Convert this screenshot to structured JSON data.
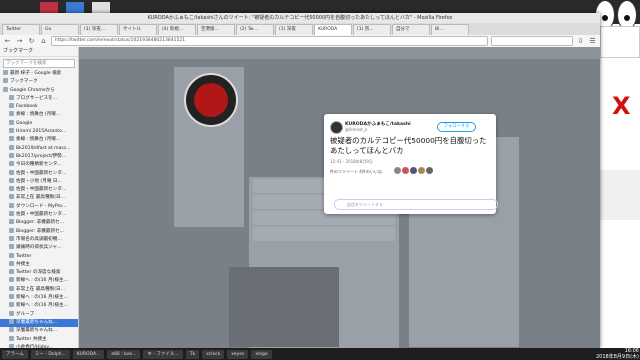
{
  "window": {
    "title": "KURODAかふぁもこ/takashiさんのツイート: \"被疑者のカルテコピー代50000円を自腹切ったあたしってほんとバカ\" - Mozilla Firefox"
  },
  "tabs": [
    "Twitter",
    "Go",
    "(1) 深夜...",
    "サイトル",
    "(4) 新規...",
    "空港版...",
    "(2) Tw...",
    "(1) 深夜",
    "KURODA",
    "(1) 宗...",
    "自分で",
    "Bl..."
  ],
  "url": "https://twitter.com/lemeat/status/1021938480213841521",
  "bookmarks": {
    "title": "ブックマーク",
    "search_placeholder": "ブックマークを検索",
    "items": [
      {
        "label": "最新 梓子 - Google 検索",
        "selected": false
      },
      {
        "label": "ブックマーク",
        "selected": false
      },
      {
        "label": "Google Chromeから",
        "selected": false
      },
      {
        "label": "ブログサービスを...",
        "selected": false
      },
      {
        "label": "Facebook",
        "selected": false
      },
      {
        "label": "奏線 : 焼舞台 (月曜...",
        "selected": false
      },
      {
        "label": "Google",
        "selected": false
      },
      {
        "label": "Hiromi 2015Asronto...",
        "selected": false
      },
      {
        "label": "奏線 : 焼舞台 (月曜...",
        "selected": false
      },
      {
        "label": "Bk2019/dfast at mass...",
        "selected": false
      },
      {
        "label": "Bk2017/project/伊勢...",
        "selected": false
      },
      {
        "label": "今日の種類新センタ...",
        "selected": false
      },
      {
        "label": "佐賀・中国最新センタ...",
        "selected": false
      },
      {
        "label": "佐賀・小地 (月曜 日...",
        "selected": false
      },
      {
        "label": "佐賀・中国最新センタ...",
        "selected": false
      },
      {
        "label": "非常上在 最高種製(日...",
        "selected": false
      },
      {
        "label": "ダウンロード - MyPro...",
        "selected": false
      },
      {
        "label": "佐賀・中国最新センタ...",
        "selected": false
      },
      {
        "label": "Blogger: 非機最新セ...",
        "selected": false
      },
      {
        "label": "Blogger: 非機最新セ...",
        "selected": false
      },
      {
        "label": "市場名の高調最初機...",
        "selected": false
      },
      {
        "label": "鎮痛時の病状兵ジャ...",
        "selected": false
      },
      {
        "label": "Twitter",
        "selected": false
      },
      {
        "label": "共撲主",
        "selected": false
      },
      {
        "label": "Twitter の深度な検索",
        "selected": false
      },
      {
        "label": "新線へ : の(16 月(様主...",
        "selected": false
      },
      {
        "label": "非常上在 最高種製(日...",
        "selected": false
      },
      {
        "label": "新線へ : の(16 月(様主...",
        "selected": false
      },
      {
        "label": "新線へ : の(16 月(様主...",
        "selected": false
      },
      {
        "label": "グループ",
        "selected": false
      },
      {
        "label": "深層最新ちゃんね...",
        "selected": true
      },
      {
        "label": "深層最新ちゃんね...",
        "selected": false
      },
      {
        "label": "Twitter 共撲主",
        "selected": false
      },
      {
        "label": "小倉秀行/Hidey...",
        "selected": false
      }
    ]
  },
  "tweet": {
    "name": "KURODAかふぁもこ/takashi",
    "handle": "@lemeat_k",
    "follow": "フォローする",
    "text": "被疑者のカルテコピー代50000円を自腹切ったあたしってほんとバカ",
    "date": "12:41 - 2018年8月9日",
    "stats": "件のリツイート 4件のいいね",
    "reply_placeholder": "返信をツイートする"
  },
  "taskbar": {
    "tasks": [
      "アラーム",
      "ミー - Dolph...",
      "KURODA...",
      "e66 : bas...",
      "キ - ファイル...",
      "Tk",
      "xclock",
      "xeyes",
      "xlogo"
    ],
    "time": "16:06",
    "date": "2018年8月9日(木)"
  },
  "colors": {
    "accent": "#1da1f2",
    "selection": "#3a78d8",
    "desktop": "#8a1a2a"
  }
}
